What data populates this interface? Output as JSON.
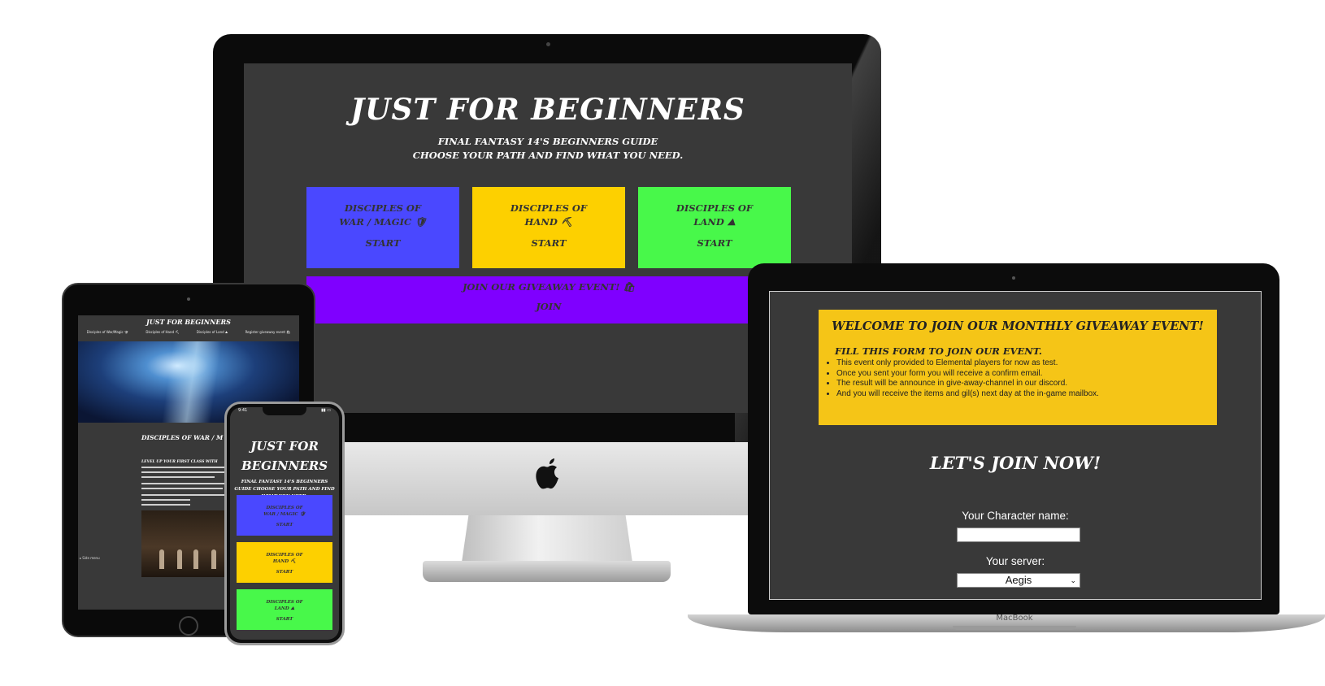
{
  "desktop": {
    "title": "Just for Beginners",
    "subtitle_line1": "Final Fantasy 14's beginners guide",
    "subtitle_line2": "Choose your path and find what you need.",
    "cards": [
      {
        "title_line1": "Disciples of",
        "title_line2": "War / Magic 🛡",
        "action": "Start",
        "color": "#4a48ff"
      },
      {
        "title_line1": "Disciples of",
        "title_line2": "Hand ⛏",
        "action": "Start",
        "color": "#fdd000"
      },
      {
        "title_line1": "Disciples of",
        "title_line2": "Land ⛰",
        "action": "Start",
        "color": "#48f84a"
      }
    ],
    "giveaway": {
      "title": "Join our giveaway event! 🛍",
      "action": "Join",
      "color": "#7f00ff"
    }
  },
  "laptop": {
    "welcome_title": "Welcome to join our monthly giveaway event!",
    "form_heading": "Fill this form to join our event.",
    "bullets": [
      "This event only provided to Elemental players for now as test.",
      "Once you sent your form you will receive a confirm email.",
      "The result will be announce in give-away-channel in our discord.",
      "And you will receive the items and gil(s) next day at the in-game mailbox."
    ],
    "join_now": "Let's join now!",
    "character_label": "Your Character name:",
    "character_value": "",
    "server_label": "Your server:",
    "server_value": "Aegis",
    "brand": "MacBook"
  },
  "tablet": {
    "title": "Just for Beginners",
    "nav": [
      "Disciples of War/Magic 🛡",
      "Disciples of Hand ⛏",
      "Disciples of Land ⛰",
      "Register giveaway event 🛍"
    ],
    "section_title": "Disciples of War / M",
    "section_sub": "Level up your first class with",
    "side_link": "▸ Side menu"
  },
  "phone": {
    "time": "9:41",
    "title_line1": "Just for",
    "title_line2": "Beginners",
    "subtitle": "Final Fantasy 14's beginners guide Choose your path and find what you need.",
    "cards": [
      {
        "title_line1": "Disciples of",
        "title_line2": "War / Magic 🛡",
        "action": "Start"
      },
      {
        "title_line1": "Disciples of",
        "title_line2": "Hand ⛏",
        "action": "Start"
      },
      {
        "title_line1": "Disciples of",
        "title_line2": "Land ⛰",
        "action": "Start"
      }
    ]
  },
  "colors": {
    "page_bg": "#393939",
    "war": "#4a48ff",
    "hand": "#fdd000",
    "land": "#48f84a",
    "giveaway": "#7f00ff",
    "banner": "#f5c517"
  }
}
